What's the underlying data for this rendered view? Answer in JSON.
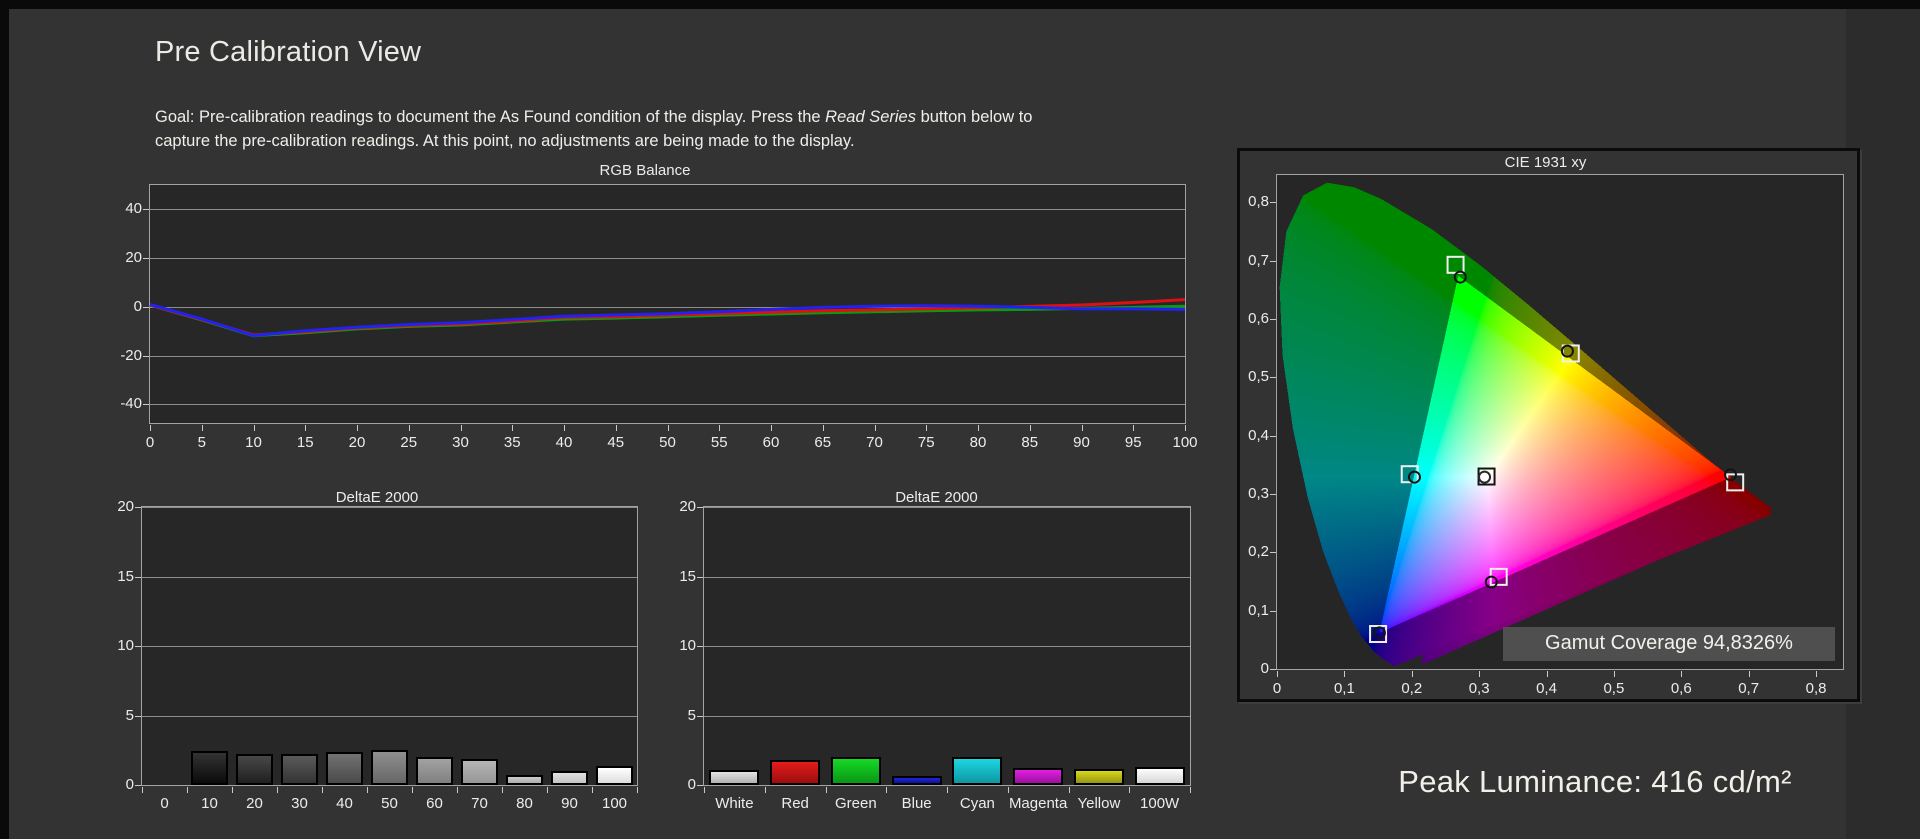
{
  "page": {
    "title": "Pre Calibration View",
    "goal": {
      "line1_pre": "Goal: Pre-calibration readings to document the As Found condition of the display. Press the ",
      "read_series": "Read Series",
      "line1_post": " button below to",
      "line2": "capture the pre-calibration readings. At this point, no adjustments are being made to the display."
    },
    "peak_luminance": "Peak Luminance: 416 cd/m²"
  },
  "colors": {
    "background": "#333333",
    "frame": "#0a0a0a",
    "plot_background": "#272727",
    "plot_border": "#a3a3a3",
    "gridline": "#8d8d8d",
    "text": "#ececec",
    "rgb_red": "#dd1111",
    "rgb_green": "#0c9a12",
    "rgb_blue": "#2222ee"
  },
  "chart_data": [
    {
      "type": "line",
      "title": "RGB Balance",
      "x": [
        0,
        5,
        10,
        15,
        20,
        25,
        30,
        35,
        40,
        45,
        50,
        55,
        60,
        65,
        70,
        75,
        80,
        85,
        90,
        95,
        100
      ],
      "series": [
        {
          "name": "Green",
          "color": "#0c9a12",
          "values": [
            0.8,
            -5.3,
            -11.8,
            -10.6,
            -9.0,
            -8.0,
            -7.4,
            -6.2,
            -5.0,
            -4.6,
            -4.0,
            -3.4,
            -2.9,
            -2.4,
            -2.0,
            -1.6,
            -1.2,
            -1.0,
            -0.6,
            -0.2,
            0.3
          ]
        },
        {
          "name": "Red",
          "color": "#dd1111",
          "values": [
            0.8,
            -5.2,
            -11.5,
            -10.2,
            -8.6,
            -7.6,
            -7.0,
            -5.8,
            -4.3,
            -4.0,
            -3.4,
            -2.8,
            -2.2,
            -1.6,
            -1.2,
            -0.8,
            -0.3,
            0.2,
            0.8,
            1.8,
            3.0
          ]
        },
        {
          "name": "Blue",
          "color": "#2222ee",
          "values": [
            1.0,
            -5.0,
            -11.7,
            -9.8,
            -8.3,
            -7.2,
            -6.5,
            -5.2,
            -3.8,
            -3.3,
            -2.8,
            -2.0,
            -1.0,
            -0.2,
            0.3,
            0.5,
            0.3,
            -0.2,
            -0.8,
            -0.8,
            -1.0
          ]
        }
      ],
      "xticks": [
        0,
        5,
        10,
        15,
        20,
        25,
        30,
        35,
        40,
        45,
        50,
        55,
        60,
        65,
        70,
        75,
        80,
        85,
        90,
        95,
        100
      ],
      "yticks": [
        -40,
        -20,
        0,
        20,
        40
      ],
      "ylim": [
        -47.6,
        50
      ],
      "xlabel": "",
      "ylabel": "",
      "grid": true,
      "legend": "none"
    },
    {
      "type": "bar",
      "title": "DeltaE 2000",
      "categories": [
        "0",
        "10",
        "20",
        "30",
        "40",
        "50",
        "60",
        "70",
        "80",
        "90",
        "100"
      ],
      "values": [
        0,
        2.45,
        2.2,
        2.2,
        2.4,
        2.55,
        2.0,
        1.9,
        0.7,
        1.0,
        1.35
      ],
      "bar_colors": [
        {
          "light": "#2a2a2a",
          "dark": "#060606"
        },
        {
          "light": "#333333",
          "dark": "#0b0b0b"
        },
        {
          "light": "#484848",
          "dark": "#202020"
        },
        {
          "light": "#5a5a5a",
          "dark": "#343434"
        },
        {
          "light": "#727272",
          "dark": "#4a4a4a"
        },
        {
          "light": "#8f8f8f",
          "dark": "#676767"
        },
        {
          "light": "#a2a2a2",
          "dark": "#808080"
        },
        {
          "light": "#b6b6b6",
          "dark": "#969696"
        },
        {
          "light": "#cccccc",
          "dark": "#adadad"
        },
        {
          "light": "#e0e0e0",
          "dark": "#c5c5c5"
        },
        {
          "light": "#ffffff",
          "dark": "#dddddd"
        }
      ],
      "yticks": [
        0,
        5,
        10,
        15,
        20
      ],
      "ylim": [
        0,
        20
      ],
      "grid": true
    },
    {
      "type": "bar",
      "title": "DeltaE 2000",
      "categories": [
        "White",
        "Red",
        "Green",
        "Blue",
        "Cyan",
        "Magenta",
        "Yellow",
        "100W"
      ],
      "values": [
        1.1,
        1.8,
        2.0,
        0.65,
        2.0,
        1.2,
        1.15,
        1.3
      ],
      "bar_colors": [
        {
          "light": "#e2e2e2",
          "dark": "#b2b2b2"
        },
        {
          "light": "#e51c1c",
          "dark": "#9c0d0d"
        },
        {
          "light": "#16d926",
          "dark": "#0a9614"
        },
        {
          "light": "#2024dc",
          "dark": "#101292"
        },
        {
          "light": "#1cd6e0",
          "dark": "#0e97a2"
        },
        {
          "light": "#e320e3",
          "dark": "#9c109c"
        },
        {
          "light": "#d8d820",
          "dark": "#96960f"
        },
        {
          "light": "#fdfdfd",
          "dark": "#d6d6d6"
        }
      ],
      "yticks": [
        0,
        5,
        10,
        15,
        20
      ],
      "ylim": [
        0,
        20
      ],
      "grid": true
    },
    {
      "type": "cie",
      "title": "CIE 1931 xy",
      "xlim": [
        0,
        0.84
      ],
      "ylim": [
        0,
        0.847
      ],
      "tick_step": 0.1,
      "xtick_labels": [
        "0",
        "0,1",
        "0,2",
        "0,3",
        "0,4",
        "0,5",
        "0,6",
        "0,7",
        "0,8"
      ],
      "ytick_labels": [
        "0",
        "0,1",
        "0,2",
        "0,3",
        "0,4",
        "0,5",
        "0,6",
        "0,7",
        "0,8"
      ],
      "gamut_coverage": "Gamut Coverage 94,8326%",
      "gamut_triangle": [
        [
          0.269,
          0.674
        ],
        [
          0.674,
          0.329
        ],
        [
          0.152,
          0.062
        ]
      ],
      "targets": [
        {
          "name": "green-target",
          "x": 0.265,
          "y": 0.693,
          "stroke": "#f0f0f0"
        },
        {
          "name": "yellow-target",
          "x": 0.436,
          "y": 0.541,
          "stroke": "#f0f0f0"
        },
        {
          "name": "red-target",
          "x": 0.68,
          "y": 0.32,
          "stroke": "#f0f0f0"
        },
        {
          "name": "magenta-target",
          "x": 0.329,
          "y": 0.158,
          "stroke": "#f0f0f0"
        },
        {
          "name": "blue-target",
          "x": 0.15,
          "y": 0.06,
          "stroke": "#f0f0f0"
        },
        {
          "name": "cyan-target",
          "x": 0.197,
          "y": 0.334,
          "stroke": "#f0f0f0"
        },
        {
          "name": "white-target",
          "x": 0.311,
          "y": 0.33,
          "stroke": "#141414"
        }
      ],
      "measured": [
        {
          "name": "green-measured",
          "x": 0.272,
          "y": 0.672,
          "stroke": "#141414",
          "fill": "none"
        },
        {
          "name": "yellow-measured",
          "x": 0.431,
          "y": 0.545,
          "stroke": "#141414",
          "fill": "none"
        },
        {
          "name": "red-measured",
          "x": 0.673,
          "y": 0.333,
          "stroke": "#141414",
          "fill": "none"
        },
        {
          "name": "magenta-measured",
          "x": 0.318,
          "y": 0.149,
          "stroke": "#141414",
          "fill": "none"
        },
        {
          "name": "blue-measured",
          "x": 0.152,
          "y": 0.062,
          "stroke": "#141414",
          "fill": "none"
        },
        {
          "name": "cyan-measured",
          "x": 0.204,
          "y": 0.329,
          "stroke": "#141414",
          "fill": "none"
        },
        {
          "name": "white-measured",
          "x": 0.308,
          "y": 0.329,
          "stroke": "#2a2a2a",
          "fill": "#ffffff"
        }
      ],
      "spectral_locus": [
        [
          0.1741,
          0.005
        ],
        [
          0.1733,
          0.0048
        ],
        [
          0.1689,
          0.0086
        ],
        [
          0.1566,
          0.0177
        ],
        [
          0.144,
          0.0297
        ],
        [
          0.1241,
          0.0578
        ],
        [
          0.1096,
          0.0868
        ],
        [
          0.0913,
          0.1327
        ],
        [
          0.0687,
          0.2007
        ],
        [
          0.0454,
          0.295
        ],
        [
          0.0235,
          0.4127
        ],
        [
          0.0082,
          0.5384
        ],
        [
          0.0039,
          0.6548
        ],
        [
          0.0139,
          0.7502
        ],
        [
          0.0389,
          0.812
        ],
        [
          0.0743,
          0.8338
        ],
        [
          0.1142,
          0.8262
        ],
        [
          0.1547,
          0.8059
        ],
        [
          0.2296,
          0.7543
        ],
        [
          0.3016,
          0.6923
        ],
        [
          0.3731,
          0.6245
        ],
        [
          0.4441,
          0.5547
        ],
        [
          0.5125,
          0.4866
        ],
        [
          0.5752,
          0.4242
        ],
        [
          0.627,
          0.3725
        ],
        [
          0.6658,
          0.334
        ],
        [
          0.6915,
          0.3083
        ],
        [
          0.7079,
          0.292
        ],
        [
          0.719,
          0.2809
        ],
        [
          0.726,
          0.274
        ],
        [
          0.7334,
          0.2666
        ],
        [
          0.7347,
          0.2653
        ]
      ],
      "shadow_offset": [
        0.062,
        -0.055
      ]
    }
  ]
}
